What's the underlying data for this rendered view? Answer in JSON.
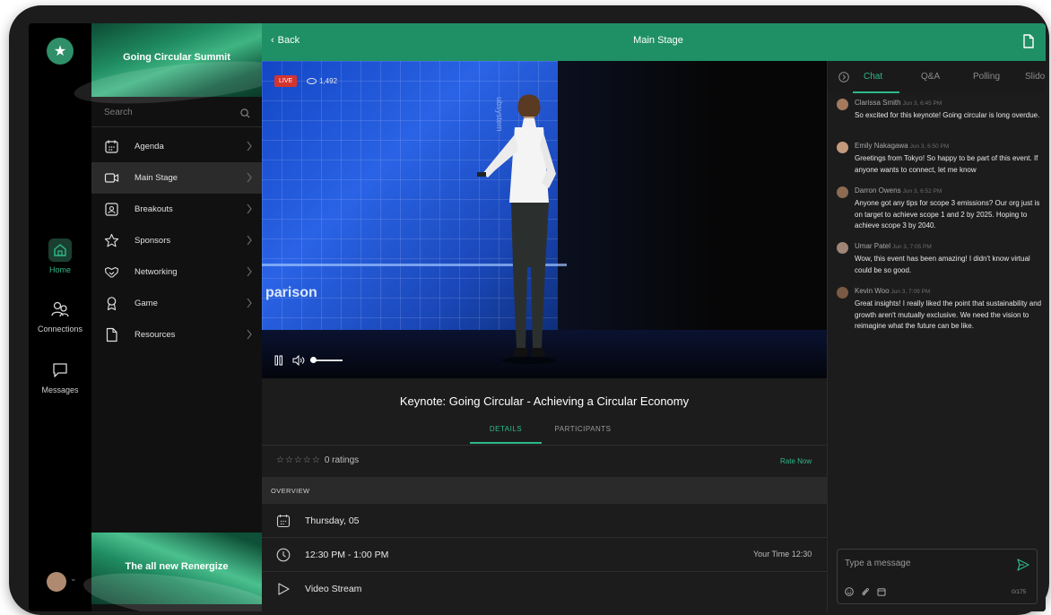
{
  "app": {
    "event_title": "Going Circular Summit",
    "promo_text": "The all new Renergize"
  },
  "rail": {
    "items": [
      {
        "label": "Home"
      },
      {
        "label": "Connections"
      },
      {
        "label": "Messages"
      }
    ]
  },
  "search": {
    "placeholder": "Search"
  },
  "menu": {
    "items": [
      {
        "label": "Agenda"
      },
      {
        "label": "Main Stage"
      },
      {
        "label": "Breakouts"
      },
      {
        "label": "Sponsors"
      },
      {
        "label": "Networking"
      },
      {
        "label": "Game"
      },
      {
        "label": "Resources"
      }
    ]
  },
  "header": {
    "back_label": "Back",
    "title": "Main Stage"
  },
  "video": {
    "live_label": "LIVE",
    "viewers": "1,492",
    "stage_text": "parison",
    "vertical_text": "ubsystem"
  },
  "session": {
    "title": "Keynote: Going Circular - Achieving a Circular Economy",
    "tabs": [
      "DETAILS",
      "PARTICIPANTS"
    ],
    "ratings_text": "0 ratings",
    "rate_now": "Rate Now",
    "overview_label": "OVERVIEW",
    "date": "Thursday, 05",
    "time": "12:30 PM - 1:00 PM",
    "your_time": "Your Time 12:30",
    "stream": "Video Stream"
  },
  "chat": {
    "tabs": [
      "Chat",
      "Q&A",
      "Polling",
      "Slido"
    ],
    "messages": [
      {
        "name": "Clarissa Smith",
        "time": "Jun 3, 6:45 PM",
        "body": "So excited for this keynote! Going circular is long overdue."
      },
      {
        "name": "Emily Nakagawa",
        "time": "Jun 3, 6:50 PM",
        "body": "Greetings from Tokyo! So happy to be part of this event. If anyone wants to connect, let me know"
      },
      {
        "name": "Darron Owens",
        "time": "Jun 3, 6:52 PM",
        "body": "Anyone got any tips for scope 3 emissions? Our org just is on target to achieve scope 1 and 2 by 2025. Hoping to achieve scope 3 by 2040."
      },
      {
        "name": "Umar Patel",
        "time": "Jun 3, 7:05 PM",
        "body": "Wow, this event has been amazing! I didn't know virtual could be so good."
      },
      {
        "name": "Kevin Woo",
        "time": "Jun 3, 7:09 PM",
        "body": "Great insights! I really liked the point that sustainability and growth aren't mutually exclusive. We need the vision to reimagine what the future can be like."
      }
    ],
    "composer_placeholder": "Type a message",
    "char_count": "0/175"
  },
  "colors": {
    "accent": "#1f9066",
    "accent_text": "#2eb889",
    "live": "#d4342f"
  }
}
